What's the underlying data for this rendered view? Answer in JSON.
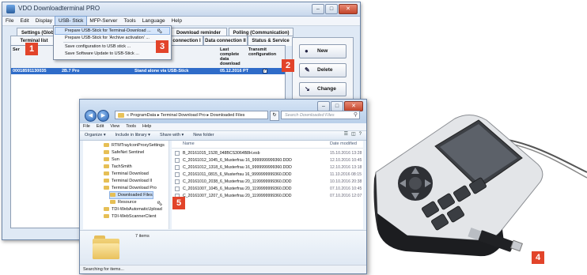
{
  "app": {
    "title": "VDO Downloadterminal PRO",
    "menu": [
      "File",
      "Edit",
      "Display",
      "USB- Stick",
      "MFP-Server",
      "Tools",
      "Language",
      "Help"
    ],
    "active_menu_index": 3,
    "tabs": [
      {
        "label": "Settings (Global)"
      },
      {
        "label": "Terminal list"
      },
      {
        "label": "Download reminder"
      },
      {
        "label": "Polling (Communication)"
      },
      {
        "label": "connection I"
      },
      {
        "label": "Data connection II"
      },
      {
        "label": "Status & Service"
      }
    ],
    "dropdown": [
      "Prepare USB-Stick for Terminal-Download ...",
      "Prepare USB-Stick for 'Archive activation' ...",
      "Save configuration to USB stick ...",
      "Save Software Update to USB-Stick ..."
    ],
    "grid": {
      "headers": [
        "Ser",
        "Last complete data download",
        "Transmit configuration"
      ],
      "row": {
        "serial": "00018591130035",
        "version": "2B.7 Pro",
        "status": "Stand alone via USB-Stick",
        "date": "05.12.2016 PT"
      }
    },
    "buttons": {
      "new": "New",
      "delete": "Delete",
      "change": "Change"
    }
  },
  "explorer": {
    "breadcrumb": "« ProgramData ▸ Terminal Download Pro ▸ Downloaded Files",
    "search_placeholder": "Search Downloaded Files",
    "menu": [
      "File",
      "Edit",
      "View",
      "Tools",
      "Help"
    ],
    "toolbar": [
      "Organize ▾",
      "Include in library ▾",
      "Share with ▾",
      "New folder"
    ],
    "tree": [
      "RTMTrayIconProxySettings",
      "SafeNet Sentinel",
      "Sun",
      "TachSmith",
      "Terminal Download",
      "Terminal Download II",
      "Terminal Download Pro",
      "Downloaded Files",
      "Resource",
      "TDI-WebAutomaticUpload",
      "TDI-WebScannerClient"
    ],
    "columns": {
      "name": "Name",
      "date": "Date modified"
    },
    "files": [
      {
        "name": "B_20161015_1528_048BCS3064B8H.esb",
        "date": "15.10.2016 13:28"
      },
      {
        "name": "C_20161012_1045_6_Musterfrau 16_9999999999360.DDD",
        "date": "12.10.2016 10:45"
      },
      {
        "name": "C_20161012_1318_6_Musterfrau 16_9999999999360.DDD",
        "date": "12.10.2016 13:18"
      },
      {
        "name": "C_20161011_0815_6_Musterfrau 16_9999999999360.DDD",
        "date": "11.10.2016 08:15"
      },
      {
        "name": "C_20161010_2038_6_Musterfrau 20_1199999999360.DDD",
        "date": "10.10.2016 20:38"
      },
      {
        "name": "C_20161007_1045_6_Musterfrau 20_1199999999360.DDD",
        "date": "07.10.2016 10:45"
      },
      {
        "name": "C_20161007_1207_6_Musterfrau 20_1199999999360.DDD",
        "date": "07.10.2016 12:07"
      }
    ],
    "item_count": "7 items",
    "status": "Searching for items..."
  },
  "markers": [
    "1",
    "2",
    "3",
    "4",
    "5"
  ],
  "colors": {
    "marker": "#e2442a",
    "selection": "#2f6cc9"
  }
}
